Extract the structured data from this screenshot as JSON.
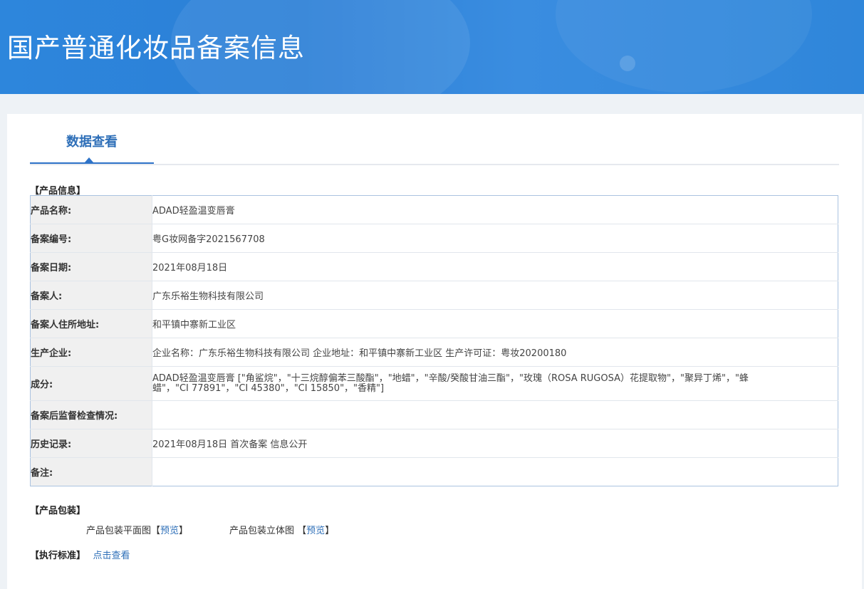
{
  "header": {
    "title": "国产普通化妆品备案信息"
  },
  "tabs": [
    {
      "label": "数据查看"
    }
  ],
  "sections": {
    "product_info": "【产品信息】",
    "packaging": "【产品包装】",
    "standard": "【执行标准】"
  },
  "product_info_rows": [
    {
      "label": "产品名称:",
      "value": "ADAD轻盈温变唇膏"
    },
    {
      "label": "备案编号:",
      "value": "粤G妆网备字2021567708"
    },
    {
      "label": "备案日期:",
      "value": "2021年08月18日"
    },
    {
      "label": "备案人:",
      "value": "广东乐裕生物科技有限公司"
    },
    {
      "label": "备案人住所地址:",
      "value": "和平镇中寨新工业区"
    },
    {
      "label": "生产企业:",
      "value": "企业名称：广东乐裕生物科技有限公司 企业地址：和平镇中寨新工业区 生产许可证：粤妆20200180"
    },
    {
      "label": "成分:",
      "value": "ADAD轻盈温变唇膏 [\"角鲨烷\"，\"十三烷醇偏苯三酸酯\"，\"地蜡\"，\"辛酸/癸酸甘油三酯\"，\"玫瑰（ROSA RUGOSA）花提取物\"，\"聚异丁烯\"，\"蜂蜡\"，\"CI 77891\"，\"CI 45380\"，\"CI 15850\"，\"香精\"]"
    },
    {
      "label": "备案后监督检查情况:",
      "value": ""
    },
    {
      "label": "历史记录:",
      "value": "2021年08月18日 首次备案 信息公开"
    },
    {
      "label": "备注:",
      "value": ""
    }
  ],
  "packaging": {
    "flat_label": "产品包装平面图",
    "flat_link_open": "【",
    "flat_link": "预览",
    "flat_link_close": "】",
    "solid_label": "产品包装立体图",
    "solid_link_open": "【",
    "solid_link": "预览",
    "solid_link_close": "】"
  },
  "standard": {
    "link": "点击查看"
  },
  "colors": {
    "banner": "#2d86dc",
    "accent": "#2e6fb8",
    "label_bg": "#f0f0f0",
    "table_border": "#aac3e0"
  }
}
